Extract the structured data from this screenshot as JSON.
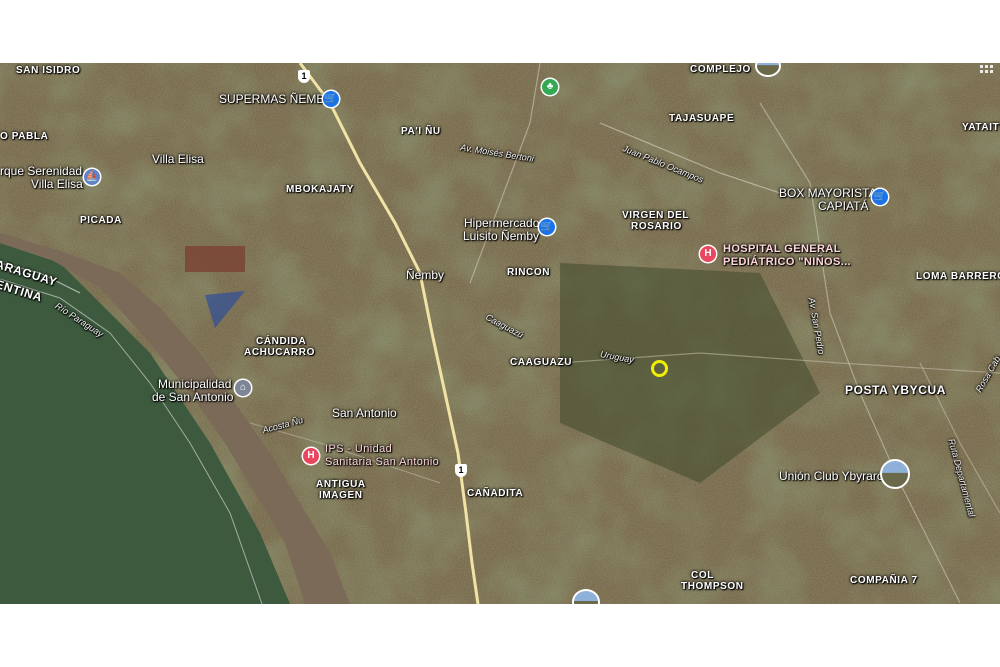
{
  "map": {
    "places": {
      "san_isidro": "SAN ISIDRO",
      "o_pabla": "O PABLA",
      "villa_elisa": "Villa Elisa",
      "parque_serenidad_1": "rque Serenidad,",
      "parque_serenidad_2": "Villa Elisa",
      "picada": "PICADA",
      "supermas": "SUPERMAS ÑEMBY",
      "paiu": "PA'I ÑU",
      "mbokajaty": "MBOKAJATY",
      "nemby": "Ñemby",
      "complejo": "COMPLEJO",
      "tajasuape": "TAJASUAPE",
      "yataity": "YATAITY",
      "box_mayorista_1": "BOX MAYORISTA",
      "box_mayorista_2": "CAPIATÁ",
      "hipermercado_1": "Hipermercado",
      "hipermercado_2": "Luisito Ñemby",
      "virgen_1": "VIRGEN DEL",
      "virgen_2": "ROSARIO",
      "hospital_1": "HOSPITAL GENERAL",
      "hospital_2": "PEDIÁTRICO \"NIÑOS...",
      "rincon": "RINCON",
      "loma_barrero": "LOMA BARRERO",
      "candida_1": "CÁNDIDA",
      "candida_2": "ACHUCARRO",
      "caaguazu": "CAAGUAZU",
      "posta_ybycua": "POSTA YBYCUA",
      "municipalidad_1": "Municipalidad",
      "municipalidad_2": "de San Antonio",
      "san_antonio": "San Antonio",
      "ips_1": "IPS - Unidad",
      "ips_2": "Sanitaria San Antonio",
      "antigua_1": "ANTIGUA",
      "antigua_2": "IMAGEN",
      "canadita": "CAÑADITA",
      "union_club": "Unión Club Ybyraró",
      "col_thompson_1": "COL",
      "col_thompson_2": "THOMPSON",
      "compania7": "COMPAÑIA 7",
      "paraguay": "ARAGUAY",
      "argentina": "ENTINA"
    },
    "roads": {
      "moises_bertoni": "Av. Moisés Bertoni",
      "juan_pablo": "Juan Pablo Ocampos",
      "caaguazu_st": "Caaguazú",
      "uruguay": "Uruguay",
      "acosta_nu": "Acosta Ñu",
      "san_pedro": "Av. San Pedro",
      "rio_paraguay": "Río Paraguay",
      "ruta_departamental": "Ruta Departamental",
      "rosa": "Rosa Cab"
    },
    "shields": {
      "route1_top": "1",
      "route1_bottom": "1"
    },
    "colors": {
      "river": "#7b6a58",
      "water_green": "#3d5a3e",
      "terrain": "#6a6040",
      "highway": "#f1e3a6",
      "marker": "#f0f000"
    },
    "icons": {
      "shop": "shopping-cart-icon",
      "hospital": "hospital-icon",
      "gov": "government-building-icon",
      "park": "park-icon",
      "boat": "boat-icon"
    }
  }
}
